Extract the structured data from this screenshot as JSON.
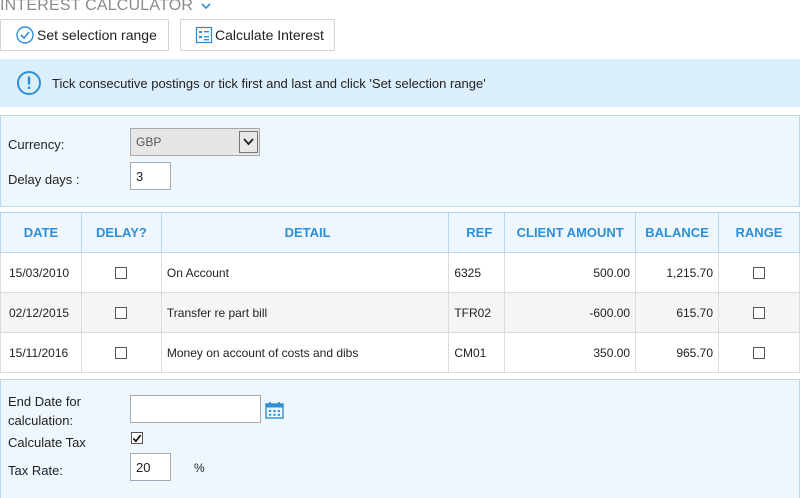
{
  "header": {
    "title": "INTEREST CALCULATOR"
  },
  "toolbar": {
    "set_range_label": "Set selection range",
    "calculate_label": "Calculate Interest"
  },
  "info": {
    "message": "Tick consecutive postings or tick first and last and click 'Set selection range'"
  },
  "settings": {
    "currency_label": "Currency:",
    "currency_value": "GBP",
    "delay_label": "Delay days :",
    "delay_value": "3"
  },
  "table": {
    "columns": {
      "date": "DATE",
      "delay": "DELAY?",
      "detail": "DETAIL",
      "ref": "REF",
      "amount": "CLIENT AMOUNT",
      "balance": "BALANCE",
      "range": "RANGE"
    },
    "rows": [
      {
        "date": "15/03/2010",
        "detail": "On Account",
        "ref": "6325",
        "amount": "500.00",
        "balance": "1,215.70"
      },
      {
        "date": "02/12/2015",
        "detail": "Transfer re part bill",
        "ref": "TFR02",
        "amount": "-600.00",
        "balance": "615.70"
      },
      {
        "date": "15/11/2016",
        "detail": "Money on account of costs and dibs",
        "ref": "CM01",
        "amount": "350.00",
        "balance": "965.70"
      }
    ]
  },
  "calc": {
    "end_date_label_1": "End Date for",
    "end_date_label_2": "calculation:",
    "end_date_value": "",
    "tax_label": "Calculate Tax",
    "tax_checked": true,
    "rate_label": "Tax Rate:",
    "rate_value": "20",
    "rate_unit": "%"
  },
  "colors": {
    "accent": "#2f8fd6",
    "info_bg": "#dbeefb",
    "panel_bg": "#eef7fd",
    "panel_border": "#b7d7ee"
  },
  "icons": {
    "title_chevron": "chevron-down-icon",
    "set_range": "check-circle-icon",
    "calculate": "calculator-icon",
    "info": "info-icon",
    "calendar": "calendar-icon"
  }
}
